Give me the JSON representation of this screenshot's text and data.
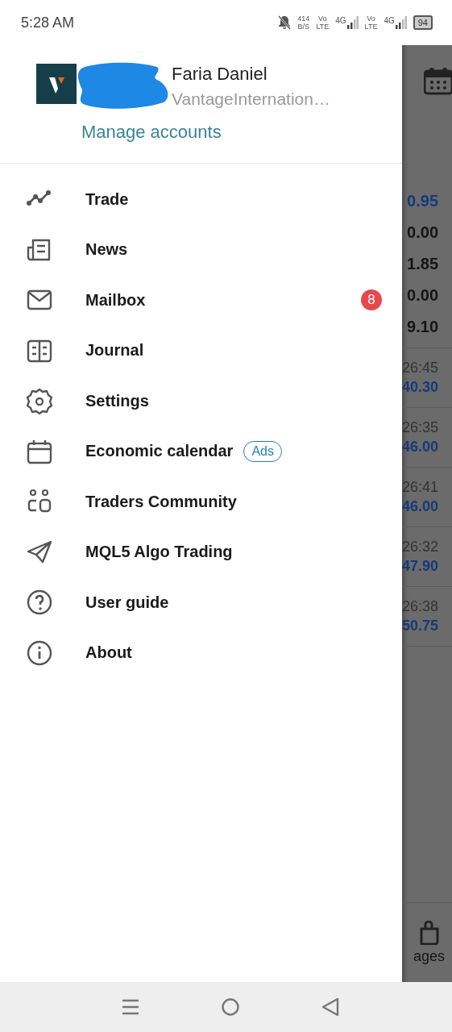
{
  "status_bar": {
    "time": "5:28 AM",
    "speed": "414",
    "speed_unit": "B/S",
    "sim1_volte": "Vo",
    "sim1_lte": "LTE",
    "sim1_net": "4G",
    "sim2_volte": "Vo",
    "sim2_lte": "LTE",
    "sim2_net": "4G",
    "battery": "94"
  },
  "account": {
    "name": "Faria Daniel",
    "server": "VantageInternation…",
    "manage_link": "Manage accounts"
  },
  "menu": [
    {
      "label": "Trade"
    },
    {
      "label": "News"
    },
    {
      "label": "Mailbox",
      "badge": "8"
    },
    {
      "label": "Journal"
    },
    {
      "label": "Settings"
    },
    {
      "label": "Economic calendar",
      "tag": "Ads"
    },
    {
      "label": "Traders Community"
    },
    {
      "label": "MQL5 Algo Trading"
    },
    {
      "label": "User guide"
    },
    {
      "label": "About"
    }
  ],
  "background": {
    "quotes": [
      {
        "value": "0.95",
        "kind": "blue"
      },
      {
        "value": "0.00",
        "kind": "dark"
      },
      {
        "value": "1.85",
        "kind": "dark"
      },
      {
        "value": "0.00",
        "kind": "dark"
      },
      {
        "value": "9.10",
        "kind": "dark"
      }
    ],
    "deals": [
      {
        "time": "26:45",
        "price": "40.30"
      },
      {
        "time": "26:35",
        "price": "46.00"
      },
      {
        "time": "26:41",
        "price": "46.00"
      },
      {
        "time": "26:32",
        "price": "47.90"
      },
      {
        "time": "26:38",
        "price": "50.75"
      }
    ],
    "tab_label": "ages"
  }
}
